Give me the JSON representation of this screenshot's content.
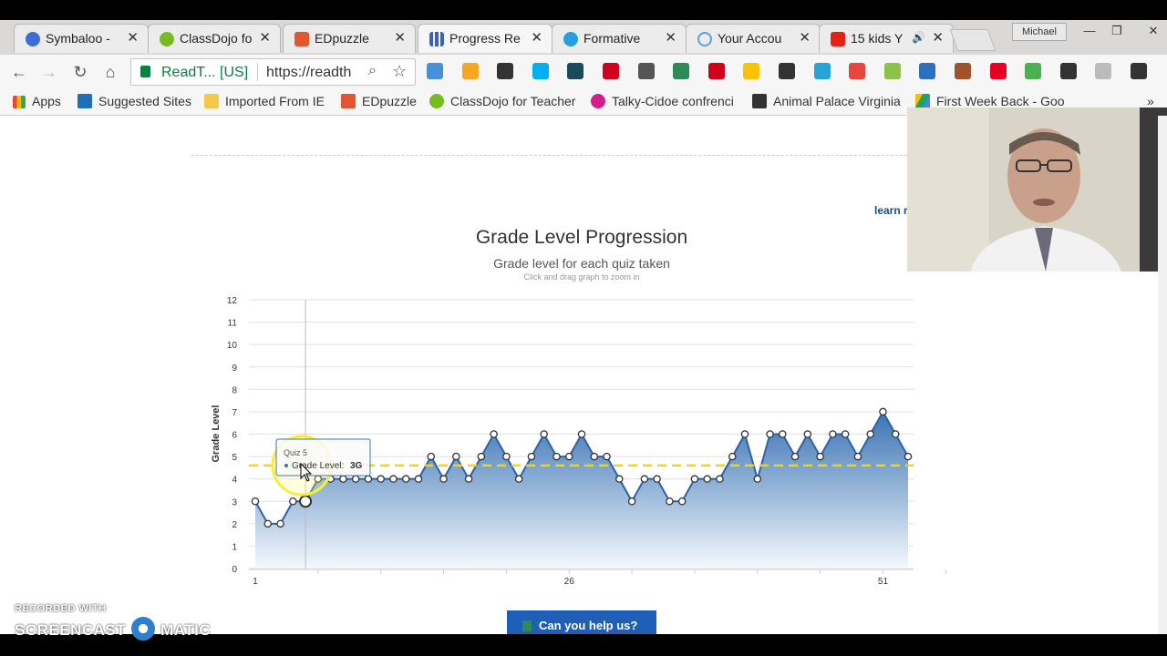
{
  "browser": {
    "tabs": [
      {
        "label": "Symbaloo -",
        "icon": "symbaloo-icon",
        "color": "#3b6fd6"
      },
      {
        "label": "ClassDojo fo",
        "icon": "classdojo-icon",
        "color": "#77bb22"
      },
      {
        "label": "EDpuzzle",
        "icon": "edpuzzle-icon",
        "color": "#e0562e"
      },
      {
        "label": "Progress Re",
        "icon": "progress-chart-icon",
        "color": "#3a63b8"
      },
      {
        "label": "Formative",
        "icon": "formative-check-icon",
        "color": "#24a0e0"
      },
      {
        "label": "Your Accou",
        "icon": "account-circle-icon",
        "color": "#5aa0e8"
      },
      {
        "label": "15 kids Y",
        "icon": "youtube-icon",
        "color": "#e62117"
      }
    ],
    "user_name": "Michael",
    "omnibox": {
      "site": "ReadT... [US]",
      "url": "https://readth"
    },
    "bookmarks": [
      {
        "label": "Apps",
        "icon": "apps-grid-icon",
        "color": "#e8453c"
      },
      {
        "label": "Suggested Sites",
        "icon": "bing-icon",
        "color": "#1f6fb5"
      },
      {
        "label": "Imported From IE",
        "icon": "folder-icon",
        "color": "#f2c94c"
      },
      {
        "label": "EDpuzzle",
        "icon": "edpuzzle-icon",
        "color": "#e0562e"
      },
      {
        "label": "ClassDojo for Teacher",
        "icon": "classdojo-icon",
        "color": "#77bb22"
      },
      {
        "label": "Talky-Cidoe confrenci",
        "icon": "talky-icon",
        "color": "#d81b8c"
      },
      {
        "label": "Animal Palace Virginia",
        "icon": "yp-icon",
        "color": "#333333"
      },
      {
        "label": "First Week Back - Goo",
        "icon": "google-drive-icon",
        "color": "#1fa463"
      }
    ],
    "extension_colors": [
      "#4a90d9",
      "#f5a623",
      "#333333",
      "#00aff0",
      "#1b4a5c",
      "#d0021b",
      "#555555",
      "#2e8b57",
      "#d0021b",
      "#f8c300",
      "#333333",
      "#29a3d6",
      "#e8453c",
      "#8bc34a",
      "#2f6fbf",
      "#a0522d",
      "#e60023",
      "#4caf50",
      "#333333",
      "#bbbbbb",
      "#333333"
    ]
  },
  "page": {
    "learn_link": "learn r",
    "help_button": "Can you help us?"
  },
  "chart_data": {
    "type": "area",
    "title": "Grade Level Progression",
    "subtitle": "Grade level for each quiz taken",
    "hint": "Click and drag graph to zoom in",
    "xlabel": "",
    "ylabel": "Grade Level",
    "x_ticks": [
      1,
      26,
      51
    ],
    "xlim": [
      1,
      53
    ],
    "ylim": [
      0,
      12
    ],
    "y_ticks": [
      0,
      1,
      2,
      3,
      4,
      5,
      6,
      7,
      8,
      9,
      10,
      11,
      12
    ],
    "series": [
      {
        "values": [
          3,
          2,
          2,
          3,
          3,
          4,
          4,
          4,
          4,
          4,
          4,
          4,
          4,
          4,
          5,
          4,
          5,
          4,
          5,
          6,
          5,
          4,
          5,
          6,
          5,
          5,
          6,
          5,
          5,
          4,
          3,
          4,
          4,
          3,
          3,
          4,
          4,
          4,
          5,
          6,
          4,
          6,
          6,
          5,
          6,
          5,
          6,
          6,
          5,
          6,
          7,
          6,
          5
        ]
      }
    ],
    "reference_line": {
      "value": 4.6,
      "color": "#f2d21b"
    },
    "highlight": {
      "x": 5,
      "value": 3
    },
    "tooltip": {
      "title": "Quiz 5",
      "label": "Grade Level: ",
      "value": "3G"
    },
    "colors": {
      "area_top": "#3a74b4",
      "area_bottom": "#f4f8fc",
      "line": "#2e62a5"
    }
  },
  "watermark": {
    "line1": "RECORDED WITH",
    "left": "SCREENCAST",
    "right": "MATIC"
  }
}
